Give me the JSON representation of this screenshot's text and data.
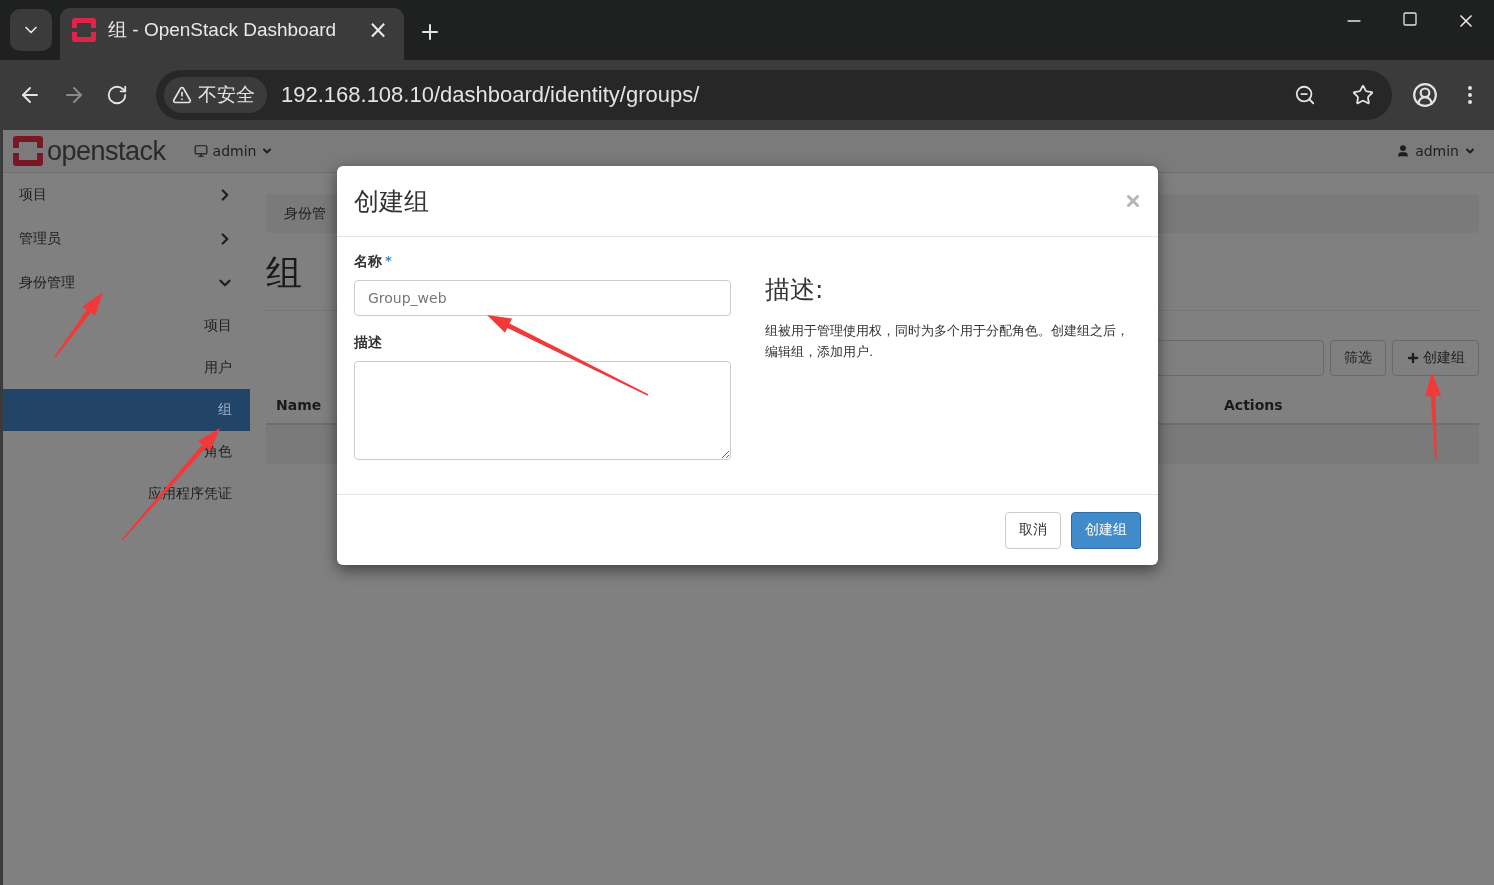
{
  "browser": {
    "tab": {
      "title": "组 - OpenStack Dashboard",
      "close": "×"
    },
    "security_label": "不安全",
    "url": "192.168.108.10/dashboard/identity/groups/"
  },
  "header": {
    "logo": "openstack",
    "project_menu": "admin",
    "user_menu": "admin"
  },
  "sidebar": {
    "items": [
      {
        "label": "项目",
        "expanded": false
      },
      {
        "label": "管理员",
        "expanded": false
      },
      {
        "label": "身份管理",
        "expanded": true,
        "children": [
          {
            "label": "项目",
            "selected": false
          },
          {
            "label": "用户",
            "selected": false
          },
          {
            "label": "组",
            "selected": true
          },
          {
            "label": "角色",
            "selected": false
          },
          {
            "label": "应用程序凭证",
            "selected": false
          }
        ]
      }
    ]
  },
  "breadcrumb": "身份管",
  "page_title": "组",
  "toolbar": {
    "filter_button": "筛选",
    "create_button": "创建组"
  },
  "table": {
    "columns": [
      "Name",
      "Actions"
    ]
  },
  "modal": {
    "title": "创建组",
    "fields": [
      {
        "kind": "input",
        "label": "名称",
        "required_mark": "*",
        "placeholder": "Group_web"
      },
      {
        "kind": "textarea",
        "label": "描述"
      }
    ],
    "help": {
      "heading": "描述:",
      "text": "组被用于管理使用权，同时为多个用于分配角色。创建组之后，编辑组，添加用户."
    },
    "buttons": [
      {
        "label": "取消",
        "primary": false
      },
      {
        "label": "创建组",
        "primary": true
      }
    ]
  }
}
